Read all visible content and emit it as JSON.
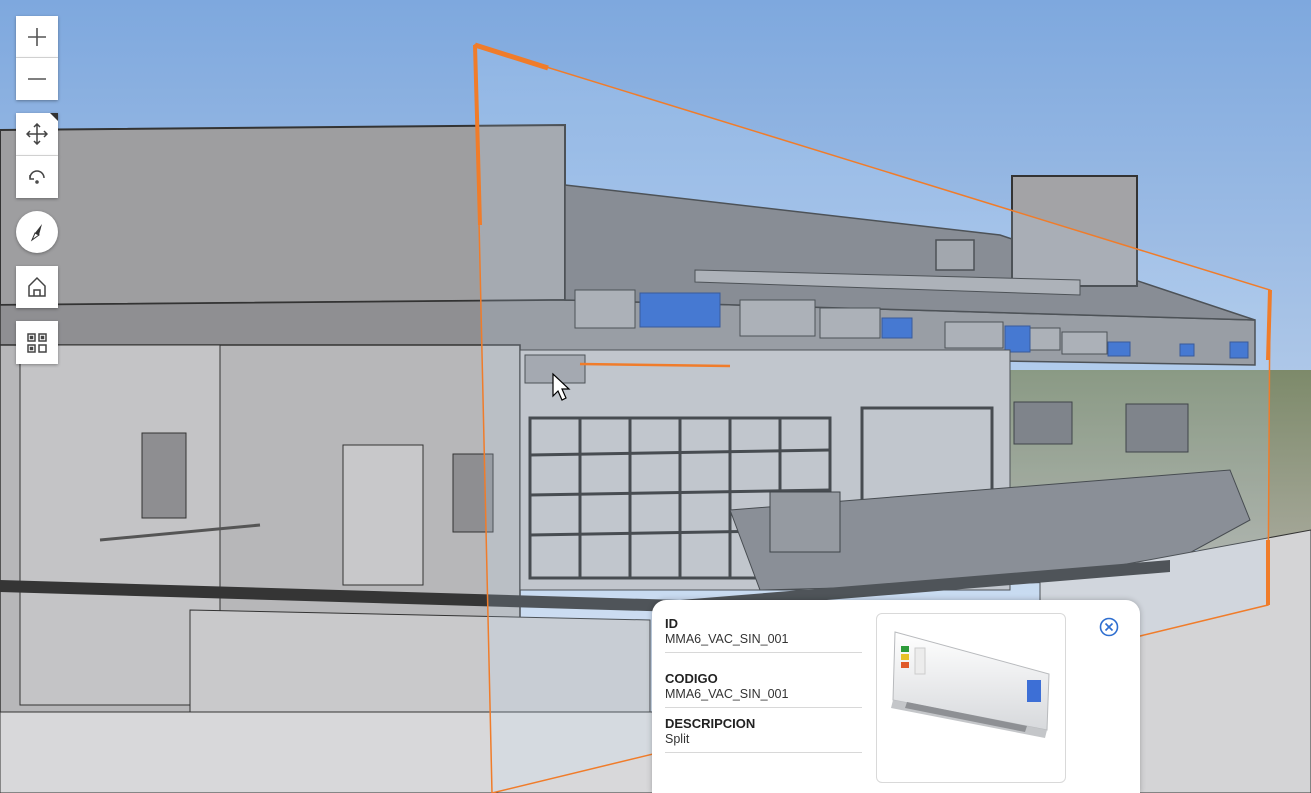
{
  "navigation": {
    "zoom_in": "zoom-in",
    "zoom_out": "zoom-out",
    "pan": "pan",
    "rotate": "rotate",
    "compass": "compass",
    "home": "home",
    "toggle": "qr-grid"
  },
  "popup": {
    "fields": [
      {
        "label": "ID",
        "value": "MMA6_VAC_SIN_001"
      },
      {
        "label": "CODIGO",
        "value": "MMA6_VAC_SIN_001"
      },
      {
        "label": "DESCRIPCION",
        "value": "Split"
      }
    ],
    "image_label": "air-conditioner-split",
    "close_icon": "close-circle-icon"
  },
  "colors": {
    "slice_outline": "#f07c2a",
    "hvac_highlight": "#2a62c9",
    "model_gray": "#a9a9ab",
    "sky_top": "#7aa6df",
    "sky_bottom": "#dfe8f2"
  }
}
